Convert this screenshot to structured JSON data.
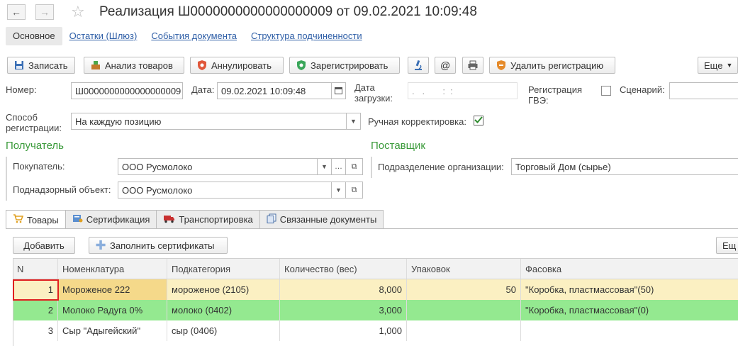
{
  "header": {
    "title": "Реализация Ш0000000000000000009 от 09.02.2021 10:09:48",
    "back_icon": "arrow-left-icon",
    "forward_icon": "arrow-right-icon",
    "star_icon": "star-icon"
  },
  "top_tabs": [
    {
      "label": "Основное",
      "active": true
    },
    {
      "label": "Остатки (Шлюз)"
    },
    {
      "label": "События документа"
    },
    {
      "label": "Структура подчиненности"
    }
  ],
  "toolbar": {
    "save": "Записать",
    "analyze": "Анализ товаров",
    "cancel": "Аннулировать",
    "register": "Зарегистрировать",
    "delete_reg": "Удалить регистрацию",
    "more": "Еще"
  },
  "form": {
    "number_label": "Номер:",
    "number_value": "Ш0000000000000000009",
    "date_label": "Дата:",
    "date_value": "09.02.2021 10:09:48",
    "load_date_label": "Дата загрузки:",
    "load_date_value": ".   .       :  :",
    "gve_label": "Регистрация ГВЭ:",
    "scenario_label": "Сценарий:",
    "scenario_value": "",
    "reg_method_label": "Способ регистрации:",
    "reg_method_value": "На каждую позицию",
    "manual_label": "Ручная корректировка:",
    "manual_checked": true
  },
  "recipient": {
    "title": "Получатель",
    "buyer_label": "Покупатель:",
    "buyer_value": "ООО Русмолоко",
    "object_label": "Поднадзорный объект:",
    "object_value": "ООО Русмолоко"
  },
  "supplier": {
    "title": "Поставщик",
    "division_label": "Подразделение организации:",
    "division_value": "Торговый Дом (сырье)"
  },
  "doc_tabs": [
    {
      "label": "Товары",
      "icon": "cart-icon",
      "active": true
    },
    {
      "label": "Сертификация",
      "icon": "certificate-icon"
    },
    {
      "label": "Транспортировка",
      "icon": "truck-icon"
    },
    {
      "label": "Связанные документы",
      "icon": "documents-icon"
    }
  ],
  "goods_toolbar": {
    "add": "Добавить",
    "fill": "Заполнить сертификаты",
    "more": "Ещ"
  },
  "table": {
    "columns": [
      "N",
      "Номенклатура",
      "Подкатегория",
      "Количество (вес)",
      "Упаковок",
      "Фасовка"
    ],
    "rows": [
      {
        "n": "1",
        "name": "Мороженое 222",
        "sub": "мороженое (2105)",
        "qty": "8,000",
        "packs": "50",
        "pack": "\"Коробка, пластмассовая\"(50)",
        "color": "#fbf0c2"
      },
      {
        "n": "2",
        "name": "Молоко Радуга 0%",
        "sub": "молоко (0402)",
        "qty": "3,000",
        "packs": "",
        "pack": "\"Коробка, пластмассовая\"(0)",
        "color": "#94e990"
      },
      {
        "n": "3",
        "name": "Сыр \"Адыгейский\"",
        "sub": "сыр (0406)",
        "qty": "1,000",
        "packs": "",
        "pack": "",
        "color": "#ffffff"
      }
    ]
  }
}
